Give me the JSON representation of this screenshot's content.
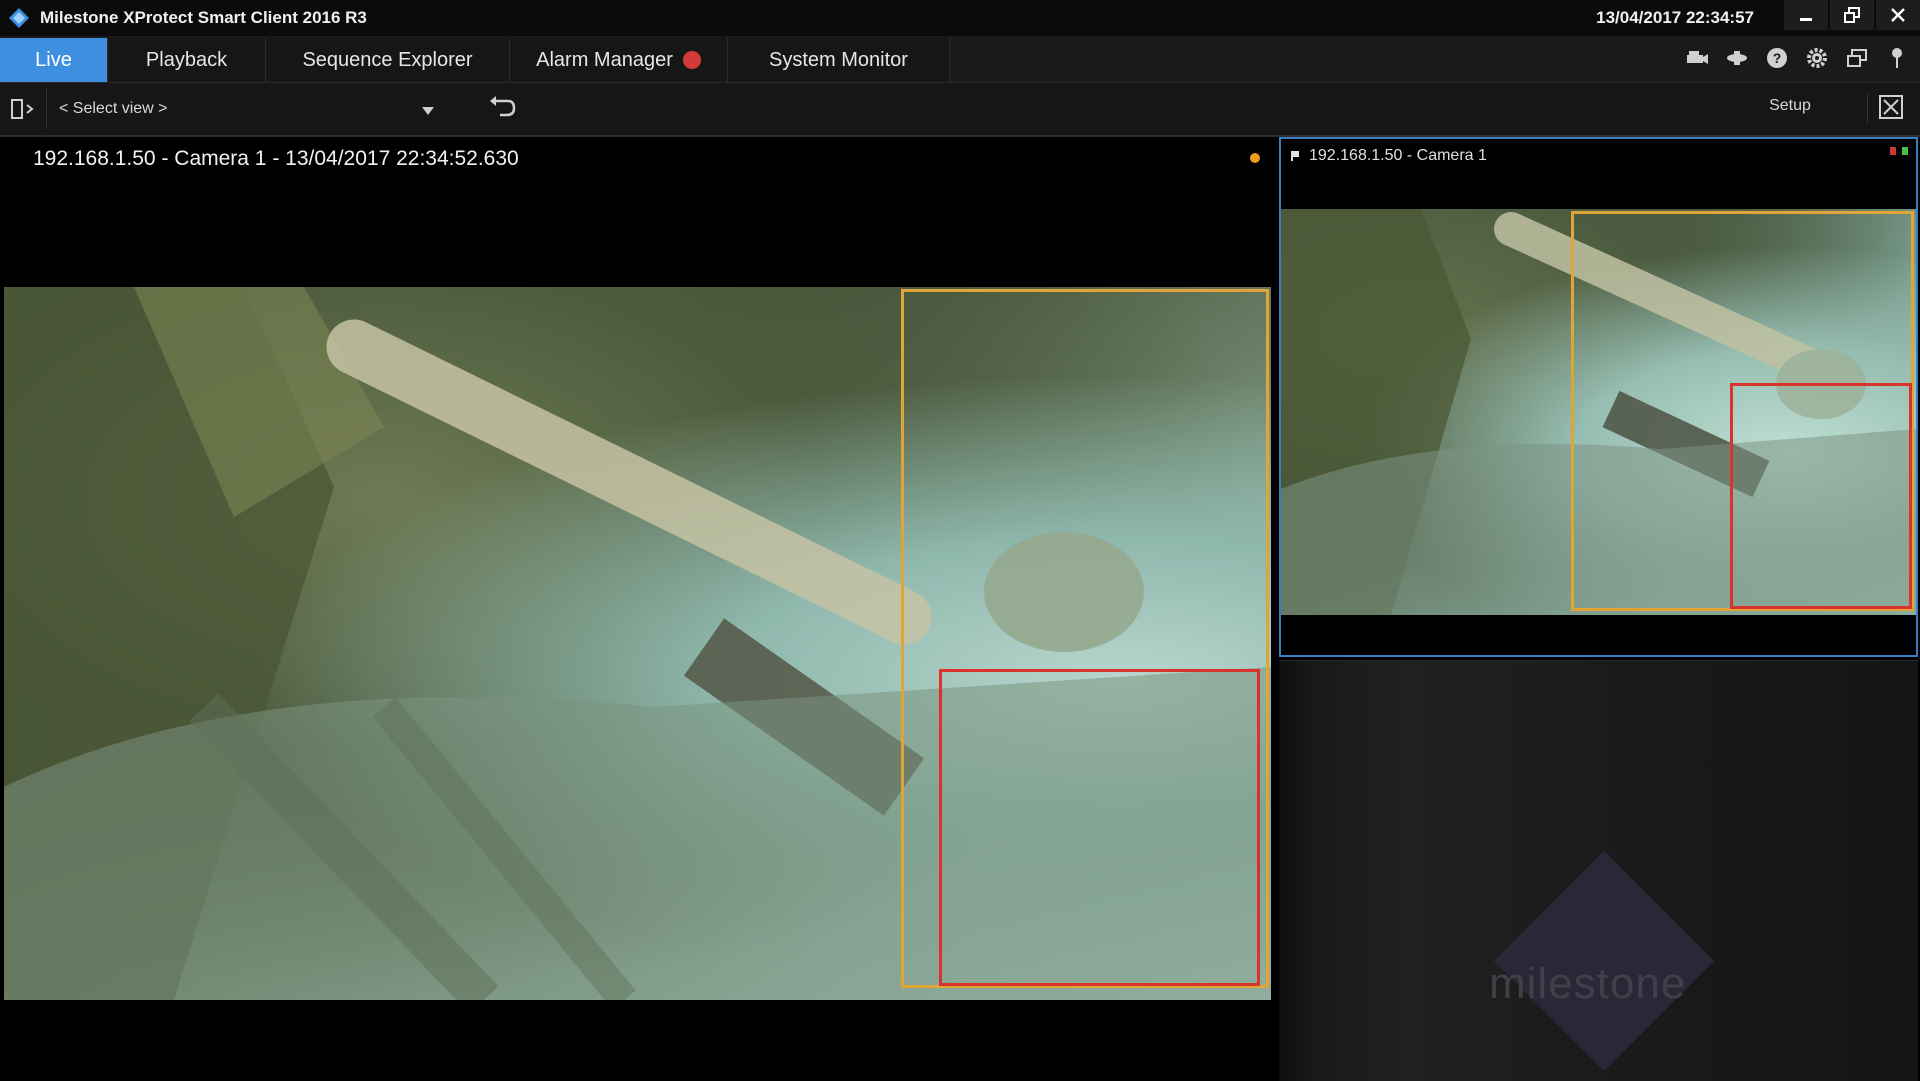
{
  "window": {
    "title": "Milestone XProtect Smart Client 2016 R3",
    "clock": "13/04/2017 22:34:57"
  },
  "tabs": [
    {
      "label": "Live",
      "active": true
    },
    {
      "label": "Playback",
      "active": false
    },
    {
      "label": "Sequence Explorer",
      "active": false
    },
    {
      "label": "Alarm Manager",
      "active": false
    },
    {
      "label": "System Monitor",
      "active": false
    }
  ],
  "viewbar": {
    "select_view": "< Select view >",
    "setup": "Setup"
  },
  "main_camera": {
    "title": "192.168.1.50 - Camera 1 - 13/04/2017 22:34:52.630"
  },
  "side_camera": {
    "title": "192.168.1.50 - Camera 1"
  },
  "empty_view": {
    "watermark": "milestone"
  },
  "colors": {
    "accent": "#3f8fe0",
    "detection_yellow": "#e0a536",
    "detection_red": "#d9342b",
    "recording": "#f09a1e"
  },
  "icons": {
    "app": "milestone-logo-icon",
    "toolbar": [
      "camera-icon",
      "bookmark-icon",
      "help-icon",
      "settings-icon",
      "window-icon",
      "pin-icon"
    ]
  }
}
